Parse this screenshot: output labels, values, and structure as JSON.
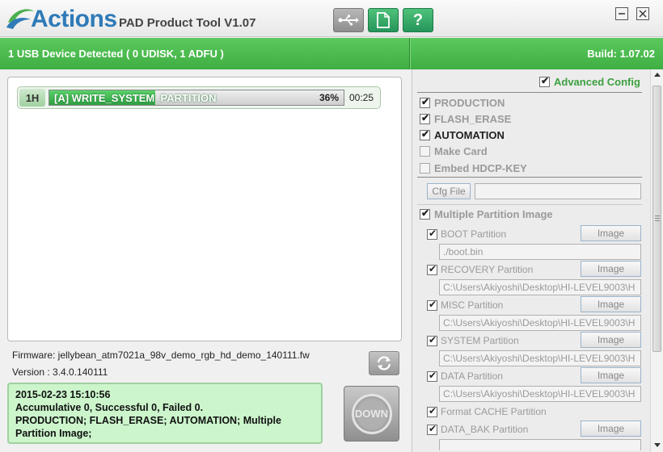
{
  "app": {
    "logo_text": "Actions",
    "title": "PAD Product Tool V1.07"
  },
  "toolbar": {
    "usb_icon": "usb-icon",
    "doc_icon": "document-icon",
    "help_label": "?"
  },
  "status": {
    "devices": "1 USB Device Detected ( 0 UDISK, 1 ADFU )",
    "build": "Build: 1.07.02"
  },
  "device": {
    "id": "1H",
    "task": "[A] WRITE_SYSTEM_PARTITION",
    "progress_percent_label": "36%",
    "progress_value": 0.36,
    "time": "00:25"
  },
  "firmware": {
    "line": "Firmware: jellybean_atm7021a_98v_demo_rgb_hd_demo_140111.fw",
    "version": "Version : 3.4.0.140111"
  },
  "log": {
    "line1": "2015-02-23 15:10:56",
    "line2": "Accumulative 0, Successful 0, Failed 0.",
    "line3": "PRODUCTION; FLASH_ERASE; AUTOMATION; Multiple Partition Image;"
  },
  "actions": {
    "down_label": "DOWN"
  },
  "config": {
    "advanced": "Advanced Config",
    "production": "PRODUCTION",
    "flash_erase": "FLASH_ERASE",
    "automation": "AUTOMATION",
    "make_card": "Make Card",
    "embed_hdcp": "Embed HDCP-KEY",
    "cfg_file_button": "Cfg File",
    "cfg_file_value": "",
    "multiple_partition": "Multiple Partition Image",
    "image_button": "Image",
    "partitions": [
      {
        "label": "BOOT Partition",
        "path": "./boot.bin"
      },
      {
        "label": "RECOVERY Partition",
        "path": "C:\\Users\\Akiyoshi\\Desktop\\HI-LEVEL9003\\H"
      },
      {
        "label": "MISC Partition",
        "path": "C:\\Users\\Akiyoshi\\Desktop\\HI-LEVEL9003\\H"
      },
      {
        "label": "SYSTEM Partition",
        "path": "C:\\Users\\Akiyoshi\\Desktop\\HI-LEVEL9003\\H"
      },
      {
        "label": "DATA Partition",
        "path": "C:\\Users\\Akiyoshi\\Desktop\\HI-LEVEL9003\\H"
      }
    ],
    "format_cache": "Format CACHE Partition",
    "data_bak": "DATA_BAK Partition",
    "data_bak_path": ""
  },
  "colors": {
    "accent_green": "#3fae43",
    "logo_blue": "#2e7ab8"
  }
}
